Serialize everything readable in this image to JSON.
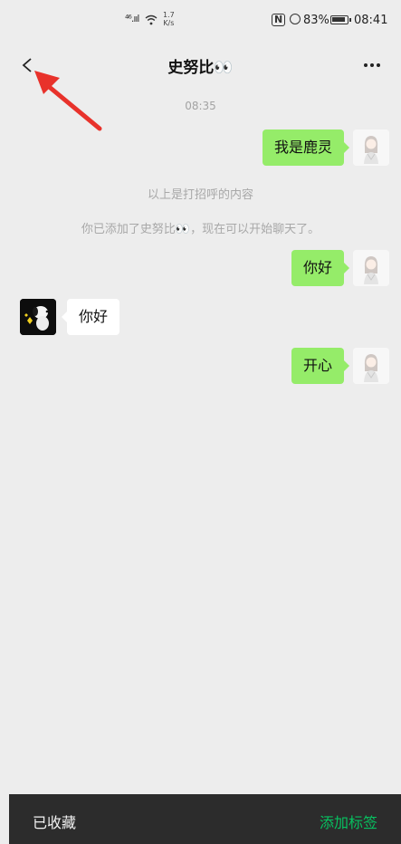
{
  "status_bar": {
    "signal": "⁴⁶.ııl",
    "speed_value": "1.7",
    "speed_unit": "K/s",
    "nfc": "N",
    "battery_percent": "83%",
    "time": "08:41"
  },
  "header": {
    "title": "史努比👀",
    "back_icon": "chevron-left-icon",
    "more_icon": "ellipsis-icon"
  },
  "chat": {
    "timestamp": "08:35",
    "messages": [
      {
        "side": "right",
        "text": "我是鹿灵"
      },
      {
        "side": "right",
        "text": "你好"
      },
      {
        "side": "left",
        "text": "你好"
      },
      {
        "side": "right",
        "text": "开心"
      }
    ],
    "system_messages": [
      "以上是打招呼的内容",
      "你已添加了史努比👀，现在可以开始聊天了。"
    ]
  },
  "bottom_bar": {
    "left_label": "已收藏",
    "right_label": "添加标签"
  },
  "colors": {
    "outgoing_bubble": "#95ec69",
    "incoming_bubble": "#ffffff",
    "background": "#ededed",
    "accent_green": "#07c160",
    "annotation_arrow": "#e8322b"
  }
}
